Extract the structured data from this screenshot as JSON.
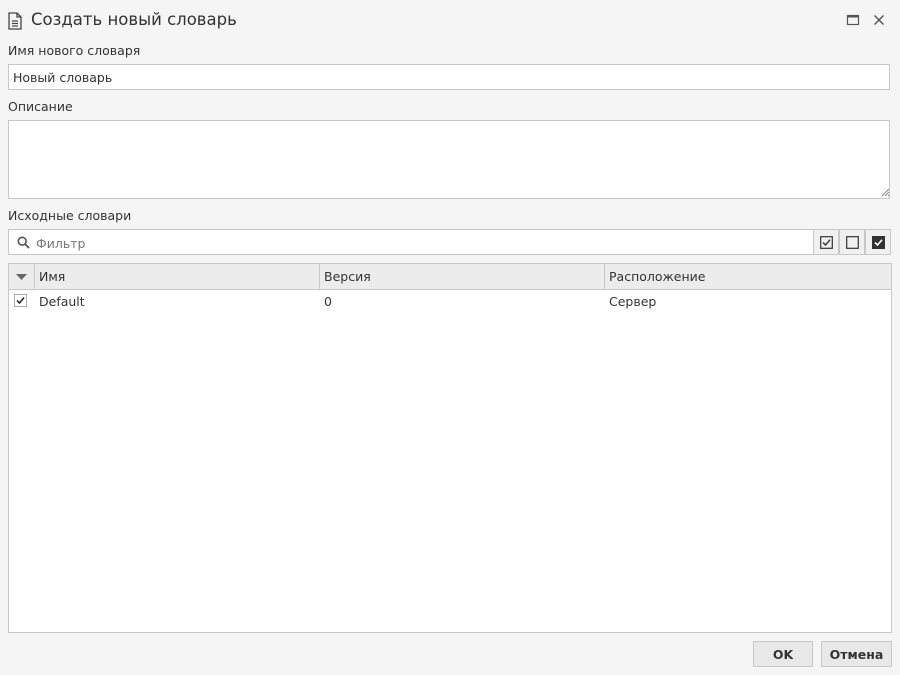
{
  "window": {
    "title": "Создать новый словарь",
    "icons": [
      "document-icon",
      "maximize-icon",
      "close-icon"
    ]
  },
  "form": {
    "name_label": "Имя нового словаря",
    "name_value": "Новый словарь",
    "description_label": "Описание",
    "description_value": "",
    "sources_label": "Исходные словари"
  },
  "filter": {
    "placeholder": "Фильтр",
    "value": "",
    "buttons": [
      "select-all-icon",
      "deselect-all-icon",
      "toggle-selection-icon"
    ]
  },
  "table": {
    "columns": [
      "Имя",
      "Версия",
      "Расположение"
    ],
    "rows": [
      {
        "checked": true,
        "name": "Default",
        "version": "0",
        "location": "Сервер"
      }
    ]
  },
  "buttons": {
    "ok": "OK",
    "cancel": "Отмена"
  },
  "colors": {
    "background": "#f5f5f5",
    "border": "#c8c8c8",
    "header": "#ececec"
  }
}
